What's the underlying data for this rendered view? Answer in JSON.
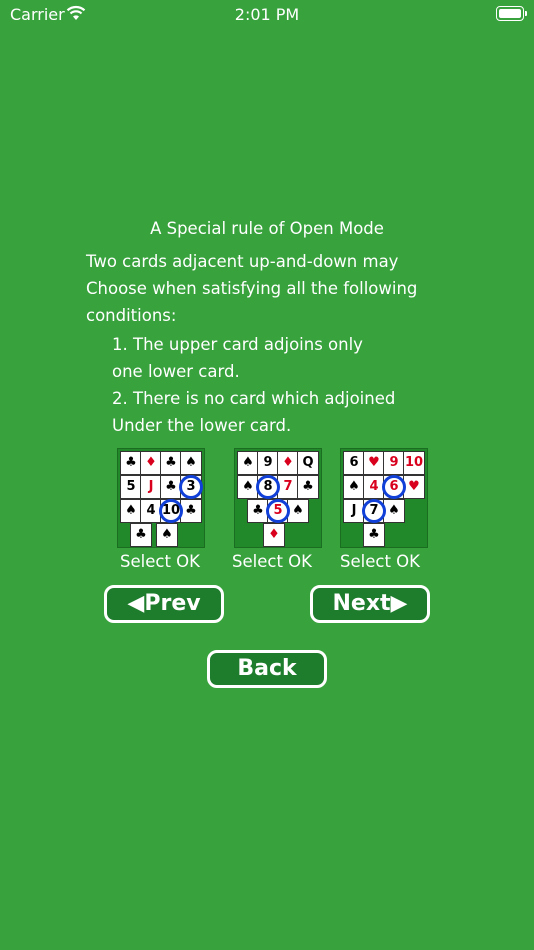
{
  "status": {
    "carrier": "Carrier",
    "time": "2:01 PM"
  },
  "content": {
    "title": "A Special rule of Open Mode",
    "lines": [
      "Two cards adjacent up-and-down may",
      "Choose when satisfying all the following",
      "conditions:",
      "1. The upper card adjoins only",
      "one lower card.",
      "2. There is no card which adjoined",
      "Under the lower card."
    ]
  },
  "examples": [
    {
      "caption": "Select OK",
      "circled": [
        "3",
        "10"
      ]
    },
    {
      "caption": "Select OK",
      "circled": [
        "8",
        "5"
      ]
    },
    {
      "caption": "Select OK",
      "circled": [
        "6",
        "7"
      ]
    }
  ],
  "buttons": {
    "prev": "◀Prev",
    "next": "Next▶",
    "back": "Back"
  },
  "colors": {
    "background": "#38a23d",
    "button": "#1e7d2c",
    "ring": "#1140d8"
  }
}
